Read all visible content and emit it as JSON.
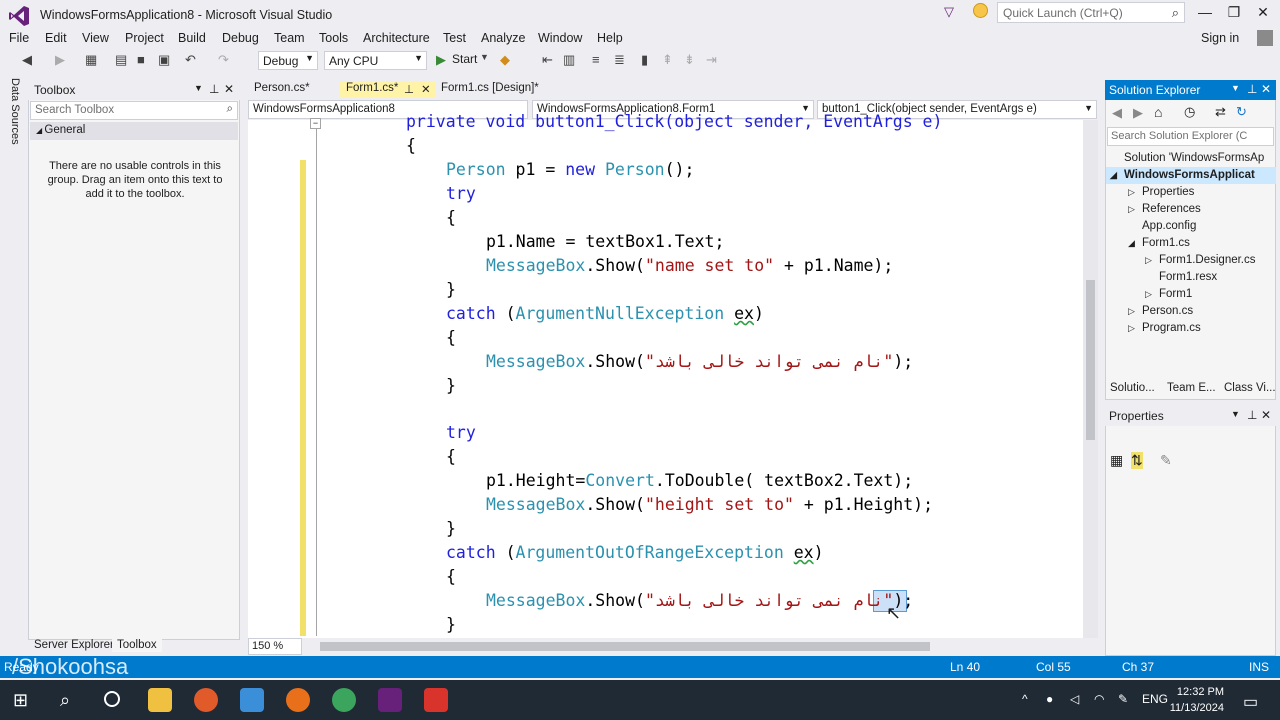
{
  "window": {
    "title": "WindowsFormsApplication8 - Microsoft Visual Studio",
    "quick_launch_placeholder": "Quick Launch (Ctrl+Q)",
    "sign_in": "Sign in"
  },
  "menu": [
    "File",
    "Edit",
    "View",
    "Project",
    "Build",
    "Debug",
    "Team",
    "Tools",
    "Architecture",
    "Test",
    "Analyze",
    "Window",
    "Help"
  ],
  "toolbar": {
    "config": "Debug",
    "platform": "Any CPU",
    "start": "Start"
  },
  "left_strip": "Data Sources",
  "toolbox": {
    "title": "Toolbox",
    "search_placeholder": "Search Toolbox",
    "group": "General",
    "empty_message": "There are no usable controls in this group. Drag an item onto this text to add it to the toolbox.",
    "bottom_tabs": [
      "Server Explorer",
      "Toolbox"
    ]
  },
  "editor": {
    "tabs": [
      "Person.cs*",
      "Form1.cs*",
      "Form1.cs [Design]*"
    ],
    "nav": [
      "WindowsFormsApplication8",
      "WindowsFormsApplication8.Form1",
      "button1_Click(object sender, EventArgs e)"
    ],
    "zoom": "150 %",
    "code": {
      "l1": "private void button1_Click(object sender, EventArgs e)",
      "l2": "{",
      "l3a": "Person",
      "l3b": " p1 = ",
      "l3c": "new",
      "l3d": " ",
      "l3e": "Person",
      "l3f": "();",
      "l4": "try",
      "l5": "{",
      "l6": "p1.Name = textBox1.Text;",
      "l7a": "MessageBox",
      "l7b": ".Show(",
      "l7c": "\"name set to\"",
      "l7d": " + p1.Name);",
      "l8": "}",
      "l9a": "catch",
      "l9b": " (",
      "l9c": "ArgumentNullException",
      "l9d": " ",
      "l9e": "ex",
      "l9f": ")",
      "l10": "{",
      "l11a": "MessageBox",
      "l11b": ".Show(",
      "l11c": "\"نام نمی تواند خالی باشد\"",
      "l11d": ");",
      "l12": "}",
      "l13": "try",
      "l14": "{",
      "l15a": "p1.Height=",
      "l15b": "Convert",
      "l15c": ".ToDouble( textBox2.Text);",
      "l16a": "MessageBox",
      "l16b": ".Show(",
      "l16c": "\"height set to\"",
      "l16d": " + p1.Height);",
      "l17": "}",
      "l18a": "catch",
      "l18b": " (",
      "l18c": "ArgumentOutOfRangeException",
      "l18d": " ",
      "l18e": "ex",
      "l18f": ")",
      "l19": "{",
      "l20a": "MessageBox",
      "l20b": ".Show(",
      "l20c": "\"نام نمی تواند خالی باشد\"",
      "l20d": ");",
      "l21": "}"
    }
  },
  "solution_explorer": {
    "title": "Solution Explorer",
    "search_placeholder": "Search Solution Explorer (C",
    "items": [
      "Solution 'WindowsFormsAp",
      "WindowsFormsApplicat",
      "Properties",
      "References",
      "App.config",
      "Form1.cs",
      "Form1.Designer.cs",
      "Form1.resx",
      "Form1",
      "Person.cs",
      "Program.cs"
    ],
    "tabs": [
      "Solutio...",
      "Team E...",
      "Class Vi..."
    ]
  },
  "properties": {
    "title": "Properties"
  },
  "status": {
    "ready": "Ready",
    "ln": "Ln 40",
    "col": "Col 55",
    "ch": "Ch 37",
    "mode": "INS"
  },
  "watermark": "/Shokoohsa",
  "taskbar": {
    "lang": "ENG",
    "time": "12:32 PM",
    "date": "11/13/2024"
  },
  "colors": {
    "accent": "#007acc",
    "keyword": "#1f1fdc",
    "type": "#2b91af",
    "string": "#a31515"
  }
}
